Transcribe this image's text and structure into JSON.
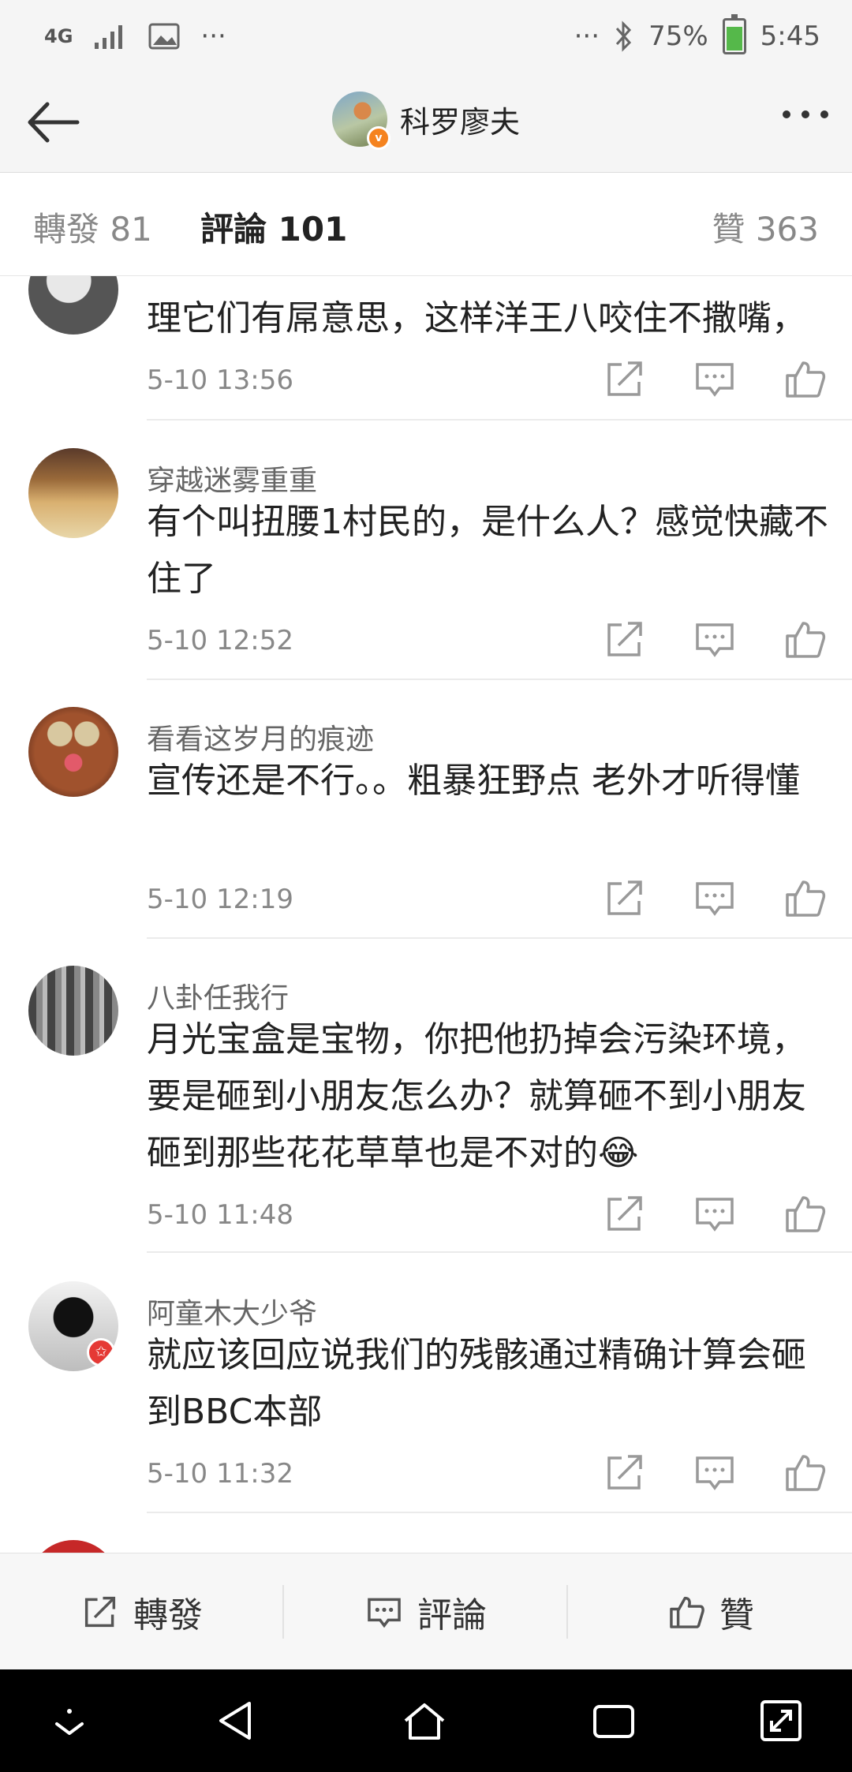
{
  "status_bar": {
    "network": "4G",
    "left_overflow": "···",
    "right_overflow": "···",
    "battery": "75%",
    "time": "5:45"
  },
  "header": {
    "title": "科罗廖夫",
    "verified_badge": "v"
  },
  "tabs": [
    {
      "label": "轉發 81"
    },
    {
      "label": "評論 101"
    },
    {
      "label": "贊 363"
    }
  ],
  "comments": [
    {
      "name": "",
      "text": "理它们有屌意思，这样洋王八咬住不撒嘴，",
      "time": "5-10 13:56"
    },
    {
      "name": "穿越迷雾重重",
      "text": "有个叫扭腰1村民的，是什么人？感觉快藏不住了",
      "time": "5-10 12:52"
    },
    {
      "name": "看看这岁月的痕迹",
      "text": "宣传还是不行。。粗暴狂野点 老外才听得懂",
      "time": "5-10 12:19"
    },
    {
      "name": "八卦任我行",
      "text": "月光宝盒是宝物，你把他扔掉会污染环境，要是砸到小朋友怎么办？就算砸不到小朋友砸到那些花花草草也是不对的😂",
      "time": "5-10 11:48"
    },
    {
      "name": "阿童木大少爷",
      "text": "就应该回应说我们的残骸通过精确计算会砸到BBC本部",
      "time": "5-10 11:32"
    },
    {
      "name": "",
      "text": "",
      "time": ""
    }
  ],
  "bottom_bar": {
    "repost_label": "轉發",
    "comment_label": "評論",
    "like_label": "贊"
  },
  "colors": {
    "accent": "#f5831f",
    "header_bg": "#f5f5f5",
    "navbar_bg": "#000000"
  }
}
